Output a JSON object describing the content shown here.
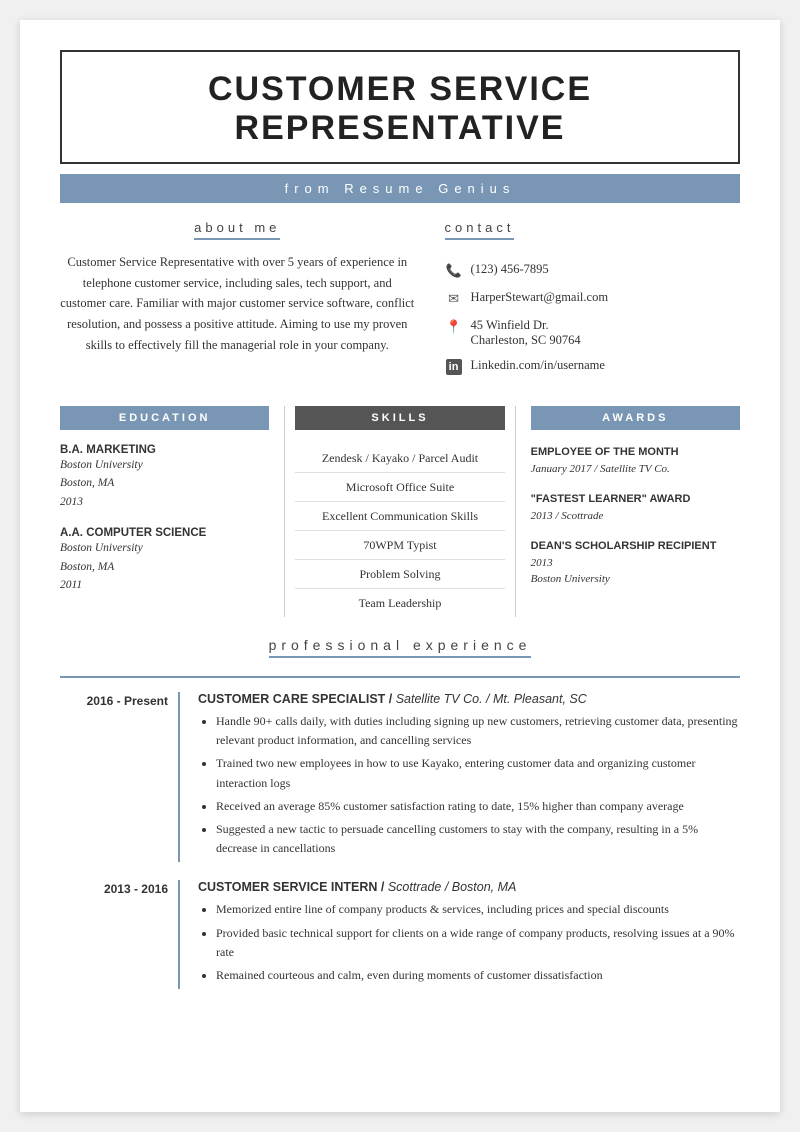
{
  "header": {
    "title": "CUSTOMER SERVICE REPRESENTATIVE",
    "subtitle": "from Resume Genius"
  },
  "about": {
    "heading": "about me",
    "text": "Customer Service Representative with over 5 years of experience in telephone customer service, including sales, tech support, and customer care. Familiar with major customer service software, conflict resolution, and possess a positive attitude. Aiming to use my proven skills to effectively fill the managerial role in your company."
  },
  "contact": {
    "heading": "contact",
    "phone": "(123) 456-7895",
    "email": "HarperStewart@gmail.com",
    "address_line1": "45 Winfield Dr.",
    "address_line2": "Charleston, SC 90764",
    "linkedin": "Linkedin.com/in/username"
  },
  "education": {
    "heading": "EDUCATION",
    "entries": [
      {
        "degree": "B.A. MARKETING",
        "school": "Boston University",
        "city": "Boston, MA",
        "year": "2013"
      },
      {
        "degree": "A.A. COMPUTER SCIENCE",
        "school": "Boston University",
        "city": "Boston, MA",
        "year": "2011"
      }
    ]
  },
  "skills": {
    "heading": "SKILLS",
    "items": [
      "Zendesk / Kayako / Parcel Audit",
      "Microsoft Office Suite",
      "Excellent Communication Skills",
      "70WPM Typist",
      "Problem Solving",
      "Team Leadership"
    ]
  },
  "awards": {
    "heading": "AWARDS",
    "entries": [
      {
        "title": "EMPLOYEE OF THE MONTH",
        "detail": "January 2017 / Satellite TV Co."
      },
      {
        "title": "\"FASTEST LEARNER\" AWARD",
        "detail": "2013 / Scottrade"
      },
      {
        "title": "DEAN'S SCHOLARSHIP RECIPIENT",
        "detail_line1": "2013",
        "detail_line2": "Boston University"
      }
    ]
  },
  "professional_experience": {
    "heading": "professional experience",
    "jobs": [
      {
        "date": "2016 - Present",
        "title": "CUSTOMER CARE SPECIALIST /",
        "company_location": " Satellite TV Co. /  Mt. Pleasant, SC",
        "bullets": [
          "Handle 90+ calls daily, with duties including signing up new customers, retrieving customer data, presenting relevant product information, and cancelling services",
          "Trained two new employees in how to use Kayako, entering customer data and organizing customer interaction logs",
          "Received an average 85% customer satisfaction rating to date, 15% higher than company average",
          "Suggested a new tactic to persuade cancelling customers to stay with the company, resulting in a 5% decrease in cancellations"
        ]
      },
      {
        "date": "2013 - 2016",
        "title": "CUSTOMER SERVICE INTERN /",
        "company_location": " Scottrade / Boston, MA",
        "bullets": [
          "Memorized entire line of company products & services, including prices and special discounts",
          "Provided basic technical support for clients on a wide range of company products, resolving issues at a 90% rate",
          "Remained courteous and calm, even during moments of customer dissatisfaction"
        ]
      }
    ]
  }
}
